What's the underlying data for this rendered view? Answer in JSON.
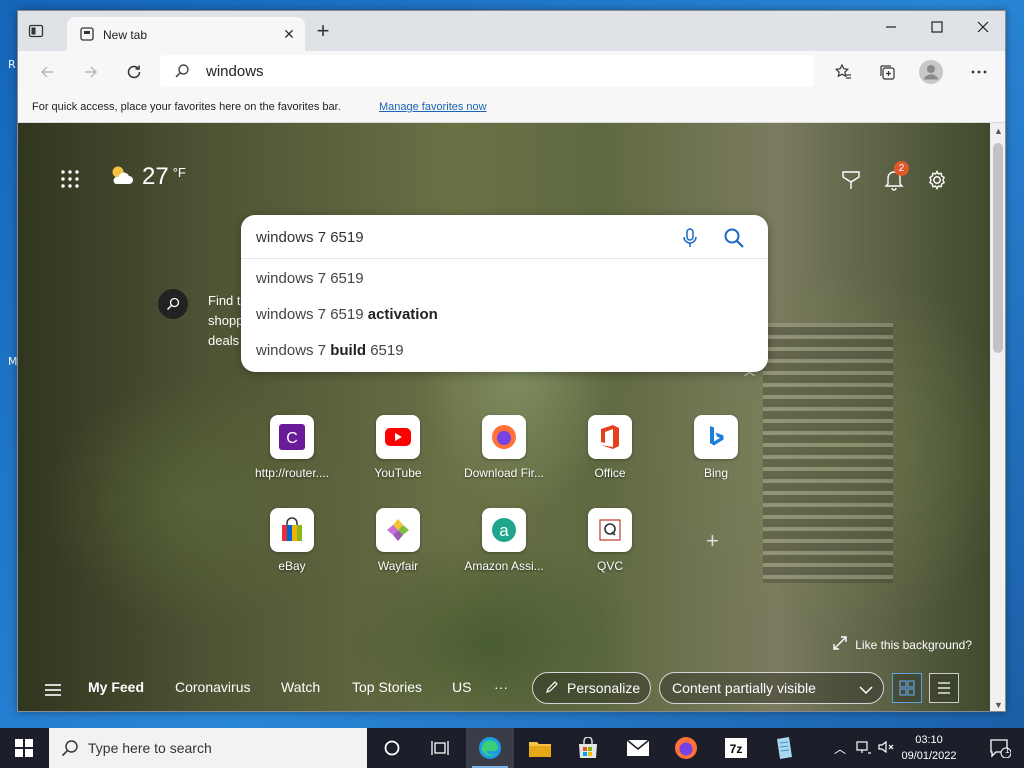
{
  "desktop": {
    "edge_letter_1": "R",
    "edge_letter_2": "M"
  },
  "browser": {
    "tab": {
      "title": "New tab"
    },
    "address": {
      "value": "windows"
    },
    "favorites_bar": {
      "message": "For quick access, place your favorites here on the favorites bar.",
      "link": "Manage favorites now"
    }
  },
  "newtab": {
    "weather": {
      "temp": "27",
      "unit": "°F",
      "icon": "partly-cloudy-icon"
    },
    "notifications_badge": "2",
    "search": {
      "query": "windows 7 6519",
      "suggestions": [
        {
          "prefix": "windows 7 6519",
          "bold": "",
          "suffix": ""
        },
        {
          "prefix": "windows 7 6519 ",
          "bold": "activation",
          "suffix": ""
        },
        {
          "prefix": "windows 7 ",
          "bold": "build",
          "suffix": " 6519"
        }
      ]
    },
    "behind_text": [
      "Find t",
      "shopp",
      "deals"
    ],
    "tiles": [
      {
        "label": "http://router....",
        "icon": "router-c-icon"
      },
      {
        "label": "YouTube",
        "icon": "youtube-icon"
      },
      {
        "label": "Download Fir...",
        "icon": "firefox-icon"
      },
      {
        "label": "Office",
        "icon": "office-icon"
      },
      {
        "label": "Bing",
        "icon": "bing-icon"
      },
      {
        "label": "eBay",
        "icon": "ebay-bag-icon"
      },
      {
        "label": "Wayfair",
        "icon": "wayfair-icon"
      },
      {
        "label": "Amazon Assi...",
        "icon": "amazon-assistant-icon"
      },
      {
        "label": "QVC",
        "icon": "qvc-icon"
      }
    ],
    "background_prompt": "Like this background?",
    "feed": {
      "tabs": [
        "My Feed",
        "Coronavirus",
        "Watch",
        "Top Stories",
        "US"
      ],
      "more": "···",
      "personalize": "Personalize",
      "visibility": "Content partially visible"
    }
  },
  "taskbar": {
    "search_placeholder": "Type here to search",
    "time": "03:10",
    "date": "09/01/2022",
    "notification_count": "1"
  }
}
